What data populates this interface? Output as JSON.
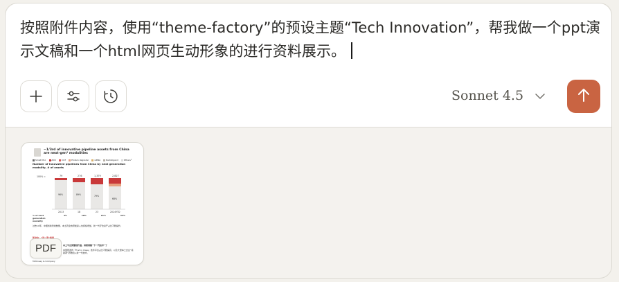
{
  "composer": {
    "prompt_text": "按照附件内容，使用“theme-factory”的预设主题“Tech Innovation”，帮我做一个ppt演示文稿和一个html网页生动形象的进行资料展示。",
    "toolbar": {
      "add_icon": "plus-icon",
      "settings_icon": "sliders-icon",
      "history_icon": "clock-icon"
    },
    "model_selector": {
      "label": "Sonnet 4.5",
      "icon": "chevron-down-icon"
    },
    "send_button": {
      "icon": "arrow-up-icon",
      "color": "#c96442"
    }
  },
  "attachment": {
    "badge": "PDF",
    "thumbnail": {
      "title": "~1/3rd of innovative pipeline assets from China are next-gen¹ modalities",
      "legend": [
        "Small Mol.",
        "ADC",
        "CGT",
        "Protein degrader",
        "siRNA",
        "Radioligand",
        "Others²"
      ],
      "subtitle": "Number of innovative pipelines from China by next generation modality, # of assets",
      "bar_totals": [
        "79",
        "276",
        "1,379",
        "2,827"
      ],
      "bar_top_axis": "100% =",
      "bar_inner": [
        "96%",
        "89%",
        "79%",
        "68%"
      ],
      "categories": [
        "2013",
        "18",
        "23",
        "2024YTD"
      ],
      "row_label": "% of next generation modality",
      "row_values": [
        "4%",
        "10%",
        "21%",
        "33%"
      ],
      "note_1": "过去10年，中国创新管线数量，本土药企的研发投入也持续增加，新一代疗法资产占比不断提升。",
      "heading_2": "新动向：“双一流”格局",
      "heading_3": "本土平台类管线升温，持续领跑“下一代技术”了",
      "note_2": "中国研发的「First in Class」技术平台占比不断提高，以及大量本土企业“领跑者”药物加入新一代技术。",
      "footer": "McKinsey & Company"
    }
  }
}
